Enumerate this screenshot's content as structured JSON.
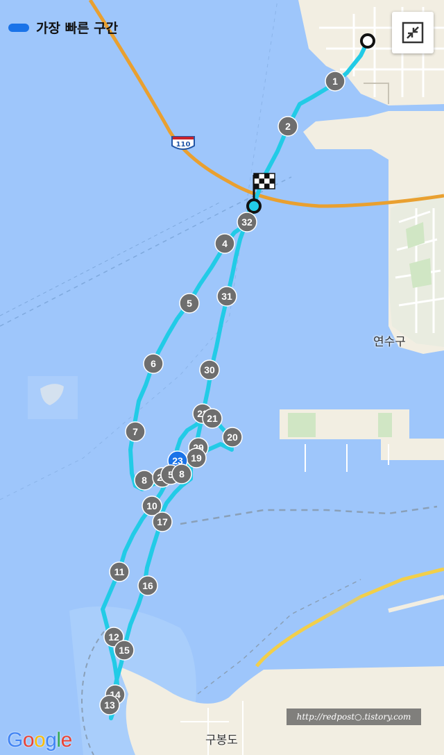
{
  "legend": {
    "label": "가장 빠른 구간",
    "color": "#1a73e8"
  },
  "expand_button": {
    "icon": "collapse-arrows-icon"
  },
  "highway_shield": "110",
  "places": [
    {
      "name": "연수구"
    },
    {
      "name": "구봉도"
    }
  ],
  "watermark": "http://redpost○.tistory.com",
  "brand": "Google",
  "route": {
    "color": "#22cbe6",
    "marker_color": "#6e6e6e",
    "highlight_color": "#1a73e8",
    "highlighted_marker": "23"
  },
  "markers": [
    "1",
    "2",
    "32",
    "4",
    "31",
    "5",
    "6",
    "30",
    "7",
    "22",
    "21",
    "20",
    "29",
    "19",
    "23",
    "8",
    "25",
    "5",
    "8",
    "10",
    "17",
    "11",
    "16",
    "12",
    "15",
    "14",
    "13"
  ]
}
